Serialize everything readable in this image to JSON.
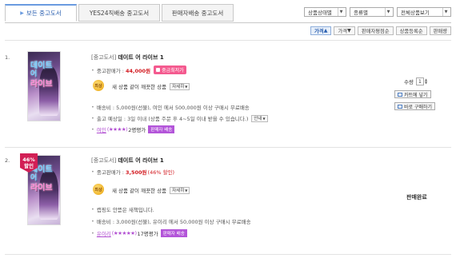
{
  "tabs": [
    {
      "label": "보든 중고도서",
      "active": true
    },
    {
      "label": "YES24직배송 중고도서",
      "active": false
    },
    {
      "label": "판매자배송 중고도서",
      "active": false
    }
  ],
  "selects": [
    "상품상태별",
    "종류별",
    "전체상품보기"
  ],
  "sort": [
    "가격",
    "가격",
    "판매자평점순",
    "상품등록순",
    "판매량"
  ],
  "sort_arrows": [
    "▲",
    "▼"
  ],
  "items": [
    {
      "index": "1.",
      "cover": {
        "line1": "데이트",
        "line2": "어",
        "line3": "라이브"
      },
      "tag": "[중고도서]",
      "title": "데이트 어 라이브 1",
      "price_label": "중고판매가 :",
      "price": "44,000원",
      "price_badge": "중금최저가",
      "grade": "최상",
      "condition": "새 상품 같이 깨끗한 상품",
      "detail_btn": "자세히",
      "shipping": "배송비 : 5,000원(선불), 여인 에서 500,000원 이상 구매시 무료배송",
      "release": "출고 예상일 : 3일 이내 (상품 주문 후 4~5일 이내 받을 수 있습니다.)",
      "release_btn": "안내",
      "seller": "여인",
      "stars": "(★★★★)",
      "reviews": "2명평가",
      "seller_badge": "판매자 배송",
      "qty_label": "수량",
      "qty": "1",
      "cart_btn": "카트에 넣기",
      "buy_btn": "바로 구매하기"
    },
    {
      "index": "2.",
      "sale_pct": "46%",
      "sale_word": "할인",
      "cover": {
        "line1": "데이트",
        "line2": "어",
        "line3": "라이브"
      },
      "tag": "[중고도서]",
      "title": "데이트 어 라이브 1",
      "price_label": "중고판매가 :",
      "price": "3,500원",
      "price_sale": "(46% 할인)",
      "grade": "최상",
      "condition": "새 상품 같이 깨끗한 상품",
      "detail_btn": "자세히",
      "note": "캡핑도 안뜯은 새책입니다.",
      "shipping": "배송비 : 3,000원(선불), 유이리 에서 50,000원 이상 구매시 무료배송",
      "seller": "유이리",
      "stars": "(★★★★★)",
      "reviews": "17명평가",
      "seller_badge": "판매자 배송",
      "soldout": "판매완료"
    }
  ],
  "colors": {
    "accent_blue": "#2a5fb0",
    "price_red": "#d2191f",
    "seller_purple": "#b355d9",
    "badge_pink": "#f45a8f"
  }
}
